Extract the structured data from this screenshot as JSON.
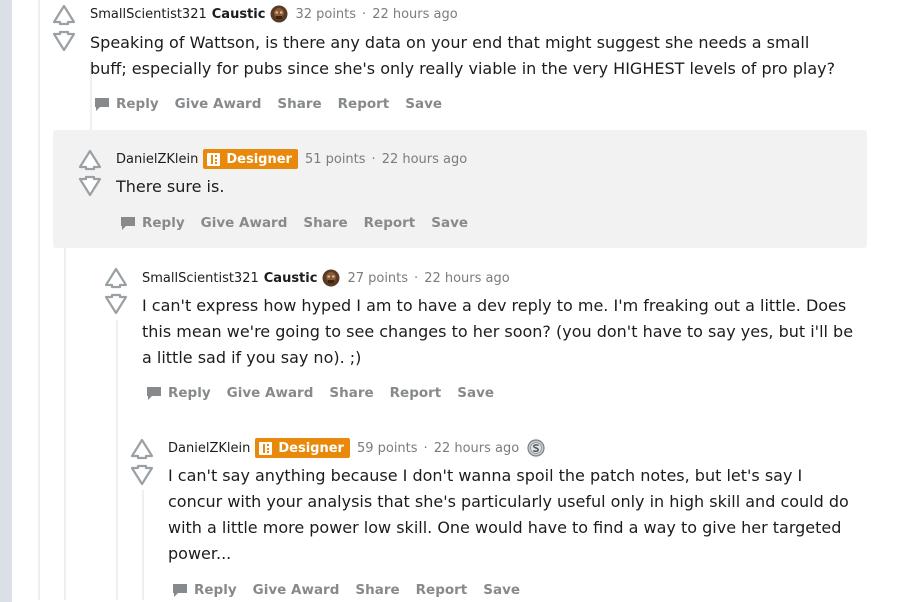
{
  "comments": [
    {
      "author": "SmallScientist321",
      "flair": "Caustic",
      "points": "32 points",
      "time": "22 hours ago",
      "body": "Speaking of Wattson, is there any data on your end that might suggest she needs a small buff; especially for pubs since she's only really viable in the very HIGHEST levels of pro play?",
      "actions": {
        "reply": "Reply",
        "award": "Give Award",
        "share": "Share",
        "report": "Report",
        "save": "Save"
      }
    },
    {
      "author": "DanielZKlein",
      "flair": "Designer",
      "points": "51 points",
      "time": "22 hours ago",
      "body": "There sure is.",
      "actions": {
        "reply": "Reply",
        "award": "Give Award",
        "share": "Share",
        "report": "Report",
        "save": "Save"
      }
    },
    {
      "author": "SmallScientist321",
      "flair": "Caustic",
      "points": "27 points",
      "time": "22 hours ago",
      "body": "I can't express how hyped I am to have a dev reply to me. I'm freaking out a little. Does this mean we're going to see changes to her soon? (you don't have to say yes, but i'll be a little sad if you say no). ;)",
      "actions": {
        "reply": "Reply",
        "award": "Give Award",
        "share": "Share",
        "report": "Report",
        "save": "Save"
      }
    },
    {
      "author": "DanielZKlein",
      "flair": "Designer",
      "points": "59 points",
      "time": "22 hours ago",
      "award_icon": "silver-award-icon",
      "body": "I can't say anything because I don't wanna spoil the patch notes, but let's say I concur with your analysis that she's particularly useful only in high skill and could do with a little more power low skill. One would have to find a way to give her targeted power...",
      "actions": {
        "reply": "Reply",
        "award": "Give Award",
        "share": "Share",
        "report": "Report",
        "save": "Save"
      }
    }
  ],
  "colors": {
    "designer_flair": "#e8890b",
    "meta_gray": "#7c7c7c",
    "action_gray": "#878a8c",
    "highlight_bg": "#f2f2f2"
  }
}
